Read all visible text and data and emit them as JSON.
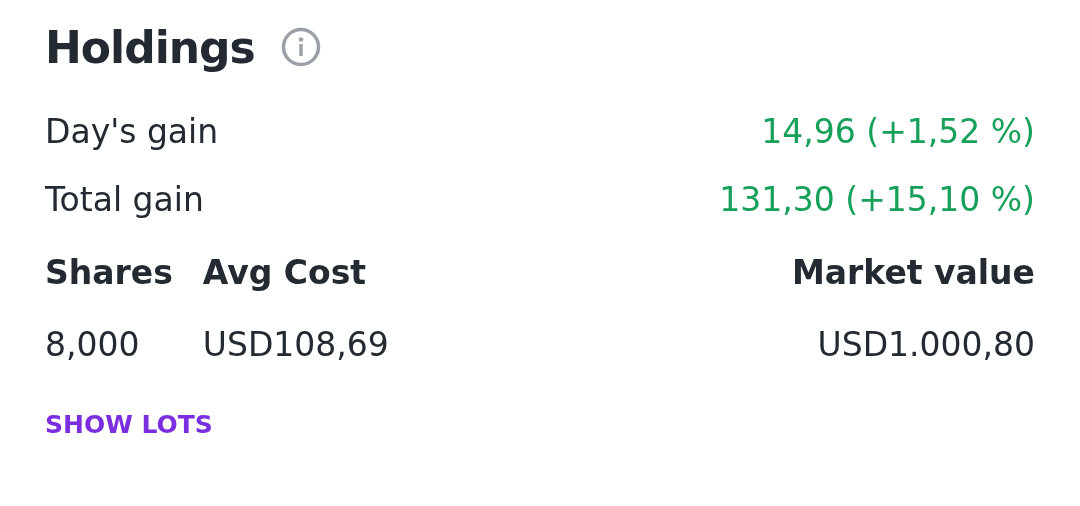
{
  "title": "Holdings",
  "gains": [
    {
      "label": "Day's gain",
      "value": "14,96 (+1,52 %)"
    },
    {
      "label": "Total gain",
      "value": "131,30 (+15,10 %)"
    }
  ],
  "columns": [
    "Shares",
    "Avg Cost",
    "Market value"
  ],
  "values": [
    "8,000",
    "USD108,69",
    "USD1.000,80"
  ],
  "link": "SHOW LOTS"
}
